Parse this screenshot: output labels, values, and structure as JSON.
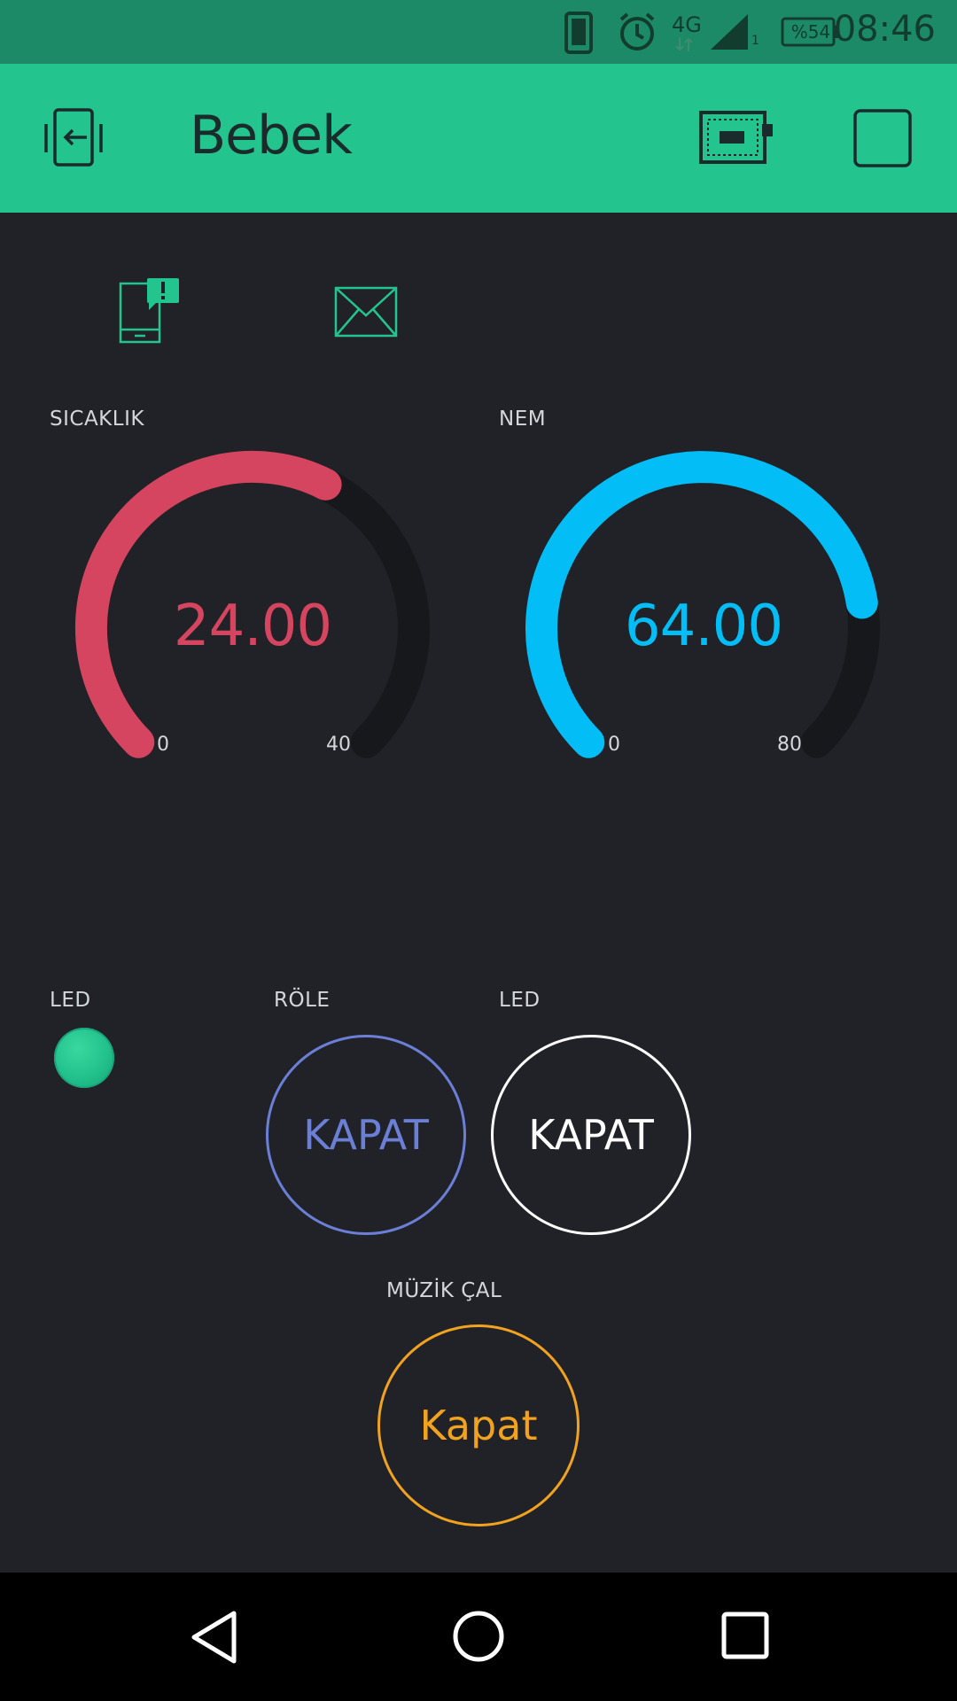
{
  "status_bar": {
    "network": "4G",
    "signal_sub": "1",
    "battery": "%54",
    "time": "08:46"
  },
  "app_bar": {
    "title": "Bebek",
    "icons": [
      "exit-icon",
      "device-icon",
      "square-icon"
    ]
  },
  "widgets": {
    "notification_icon": "phone-notification-icon",
    "email_icon": "mail-icon"
  },
  "gauges": [
    {
      "label": "SICAKLIK",
      "value": "24.00",
      "min": "0",
      "max": "40",
      "fraction": 0.6,
      "color": "#d5455f"
    },
    {
      "label": "NEM",
      "value": "64.00",
      "min": "0",
      "max": "80",
      "fraction": 0.8,
      "color": "#03bdf7"
    }
  ],
  "controls": {
    "led_label": "LED",
    "led_color": "#24c48e",
    "role_label": "RÖLE",
    "role_button": "KAPAT",
    "led2_label": "LED",
    "led2_button": "KAPAT",
    "music_label": "MÜZİK ÇAL",
    "music_button": "Kapat"
  },
  "nav": {
    "icons": [
      "back-icon",
      "home-icon",
      "recents-icon"
    ]
  },
  "colors": {
    "background": "#212227",
    "app_bar": "#24c48e",
    "status_bar": "#1c8a67",
    "accent_blue": "#6b7fd7",
    "accent_orange": "#f1a21f"
  }
}
